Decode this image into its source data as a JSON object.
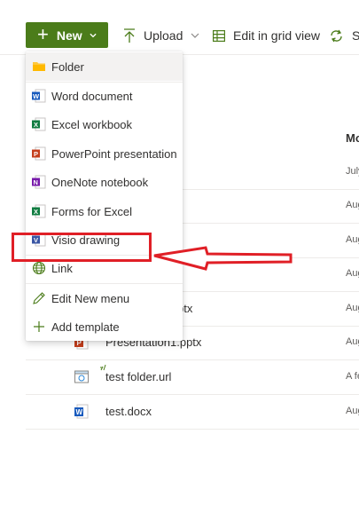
{
  "toolbar": {
    "new_label": "New",
    "upload_label": "Upload",
    "grid_label": "Edit in grid view",
    "sync_label": "Sy"
  },
  "list": {
    "column_header": "Mo",
    "rows": [
      {
        "name": "",
        "date": "July"
      },
      {
        "name": "",
        "date": "Aug"
      },
      {
        "name": "",
        "date": "Aug"
      },
      {
        "name": "",
        "date": "Aug"
      },
      {
        "name": "ptx",
        "date": "Aug"
      },
      {
        "name": "Presentation1.pptx",
        "date": "Aug"
      },
      {
        "name": "test folder.url",
        "date": "A fe"
      },
      {
        "name": "test.docx",
        "date": "Aug"
      }
    ]
  },
  "menu": {
    "items": [
      {
        "label": "Folder",
        "icon": "folder-icon"
      },
      {
        "label": "Word document",
        "icon": "word-icon"
      },
      {
        "label": "Excel workbook",
        "icon": "excel-icon"
      },
      {
        "label": "PowerPoint presentation",
        "icon": "powerpoint-icon"
      },
      {
        "label": "OneNote notebook",
        "icon": "onenote-icon"
      },
      {
        "label": "Forms for Excel",
        "icon": "forms-excel-icon"
      },
      {
        "label": "Visio drawing",
        "icon": "visio-icon"
      },
      {
        "label": "Link",
        "icon": "globe-icon"
      },
      {
        "label": "Edit New menu",
        "icon": "pencil-icon"
      },
      {
        "label": "Add template",
        "icon": "plus-icon"
      }
    ]
  },
  "colors": {
    "brand_green": "#4b7c1a",
    "annotation_red": "#e01f26"
  }
}
